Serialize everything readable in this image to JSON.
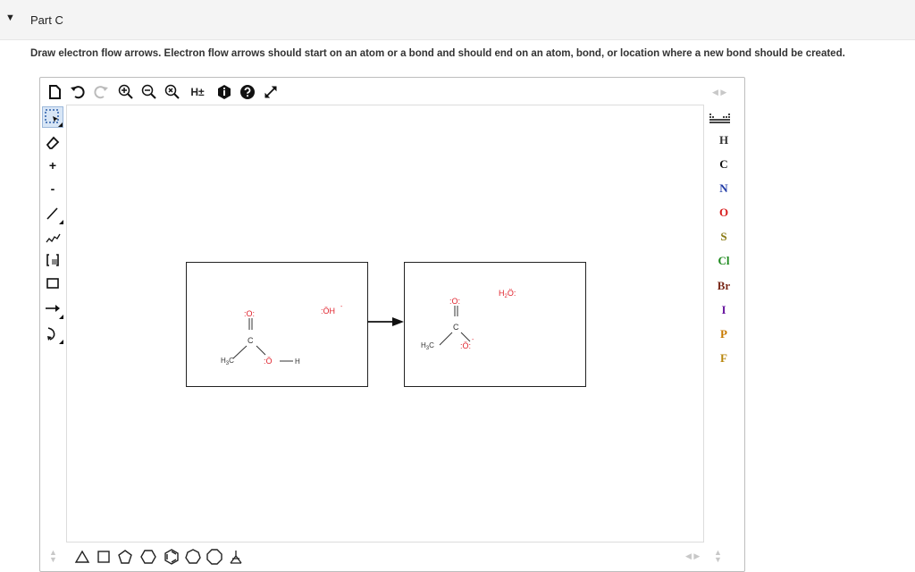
{
  "part": {
    "title": "Part C",
    "caret": "▼"
  },
  "instructions": "Draw electron flow arrows. Electron flow arrows should start on an atom or a bond and should end on an atom, bond, or location where a new bond should be created.",
  "toolbar": {
    "icons": [
      "new-document-icon",
      "undo-icon",
      "redo-icon",
      "zoom-in-icon",
      "zoom-out-icon",
      "zoom-reset-icon",
      "h-toggle",
      "info-icon",
      "help-icon",
      "fullscreen-icon"
    ],
    "h_toggle_label": "H±"
  },
  "side_tools": {
    "plus_label": "+",
    "minus_label": "-"
  },
  "elements": [
    {
      "symbol": "H",
      "color": "#333333"
    },
    {
      "symbol": "C",
      "color": "#111111"
    },
    {
      "symbol": "N",
      "color": "#1f3aa6"
    },
    {
      "symbol": "O",
      "color": "#d81e1e"
    },
    {
      "symbol": "S",
      "color": "#8a7a14"
    },
    {
      "symbol": "Cl",
      "color": "#1e8a1e"
    },
    {
      "symbol": "Br",
      "color": "#7a2a1a"
    },
    {
      "symbol": "I",
      "color": "#6a1aa0"
    },
    {
      "symbol": "P",
      "color": "#c87a00"
    },
    {
      "symbol": "F",
      "color": "#b8860b"
    }
  ],
  "reactant": {
    "carbonyl_o": ":O:",
    "carbon": "C",
    "methyl_h": "H",
    "methyl_sub": "3",
    "methyl_c": "C",
    "hydroxyl_o": ":Ö",
    "hydroxyl_h": "H",
    "hydroxide": ":ÖH",
    "hydroxide_charge": "-"
  },
  "product": {
    "water_h": "H",
    "water_sub": "2",
    "water_o": "Ö:",
    "carbonyl_o": ":O:",
    "carbon": "C",
    "methyl_h": "H",
    "methyl_sub": "3",
    "methyl_c": "C",
    "oxide_o": ":Ö:",
    "oxide_charge": "-"
  }
}
